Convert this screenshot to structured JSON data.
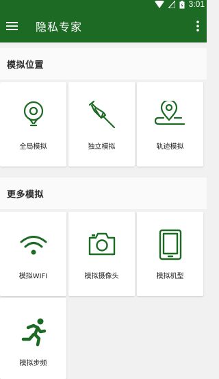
{
  "status_bar": {
    "time": "3:01",
    "icons": [
      "wifi-icon",
      "signal-icon",
      "battery-icon"
    ]
  },
  "toolbar": {
    "title": "隐私专家",
    "menu_icon": "menu-icon",
    "more_icon": "more-vert-icon"
  },
  "colors": {
    "brand": "#1d6a24",
    "background": "#f1f1f1",
    "card": "#ffffff"
  },
  "sections": [
    {
      "title": "模拟位置",
      "items": [
        {
          "label": "全局模拟",
          "icon": "map-pin-circle-icon"
        },
        {
          "label": "独立模拟",
          "icon": "push-pin-icon"
        },
        {
          "label": "轨迹模拟",
          "icon": "location-track-icon"
        }
      ]
    },
    {
      "title": "更多模拟",
      "items": [
        {
          "label": "模拟WIFI",
          "icon": "wifi-icon"
        },
        {
          "label": "模拟摄像头",
          "icon": "camera-icon"
        },
        {
          "label": "模拟机型",
          "icon": "tablet-icon"
        },
        {
          "label": "模拟步频",
          "icon": "running-person-icon"
        }
      ]
    }
  ]
}
